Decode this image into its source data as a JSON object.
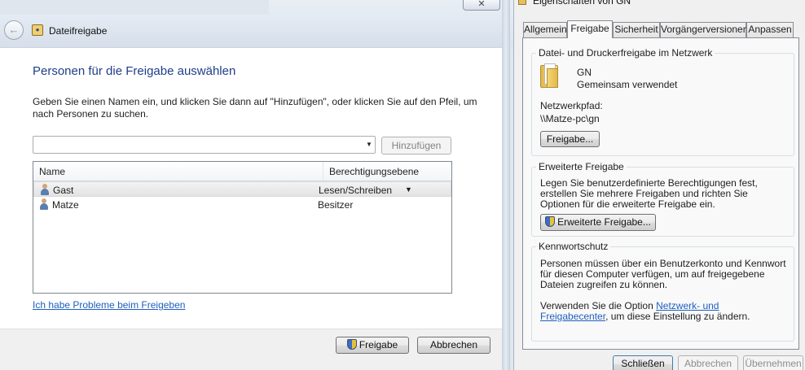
{
  "share_dialog": {
    "title": "Dateifreigabe",
    "heading": "Personen für die Freigabe auswählen",
    "instructions": "Geben Sie einen Namen ein, und klicken Sie dann auf \"Hinzufügen\", oder klicken Sie auf den Pfeil, um nach Personen zu suchen.",
    "person_input_value": "",
    "add_button": "Hinzufügen",
    "columns": {
      "name": "Name",
      "permission": "Berechtigungsebene"
    },
    "rows": [
      {
        "name": "Gast",
        "permission": "Lesen/Schreiben",
        "has_dropdown": true
      },
      {
        "name": "Matze",
        "permission": "Besitzer",
        "has_dropdown": false
      }
    ],
    "trouble_link": "Ich habe Probleme beim Freigeben",
    "share_button": "Freigabe",
    "cancel_button": "Abbrechen"
  },
  "properties": {
    "title": "Eigenschaften von GN",
    "tabs": [
      "Allgemein",
      "Freigabe",
      "Sicherheit",
      "Vorgängerversionen",
      "Anpassen"
    ],
    "active_tab": "Freigabe",
    "network_group": {
      "title": "Datei- und Druckerfreigabe im Netzwerk",
      "share_name": "GN",
      "share_status": "Gemeinsam verwendet",
      "path_label": "Netzwerkpfad:",
      "path_value": "\\\\Matze-pc\\gn",
      "button": "Freigabe..."
    },
    "advanced_group": {
      "title": "Erweiterte Freigabe",
      "text": "Legen Sie benutzerdefinierte Berechtigungen fest, erstellen Sie mehrere Freigaben und richten Sie Optionen für die erweiterte Freigabe ein.",
      "button": "Erweiterte Freigabe..."
    },
    "password_group": {
      "title": "Kennwortschutz",
      "text": "Personen müssen über ein Benutzerkonto und Kennwort für diesen Computer verfügen, um auf freigegebene Dateien zugreifen zu können.",
      "text2_before": "Verwenden Sie die Option ",
      "link": "Netzwerk- und Freigabecenter",
      "text2_after": ", um diese Einstellung zu ändern."
    },
    "buttons": {
      "close": "Schließen",
      "cancel": "Abbrechen",
      "apply": "Übernehmen"
    }
  },
  "colors": {
    "heading": "#1e3e8a",
    "link": "#1e5fbf",
    "disabled_text": "#838383"
  }
}
